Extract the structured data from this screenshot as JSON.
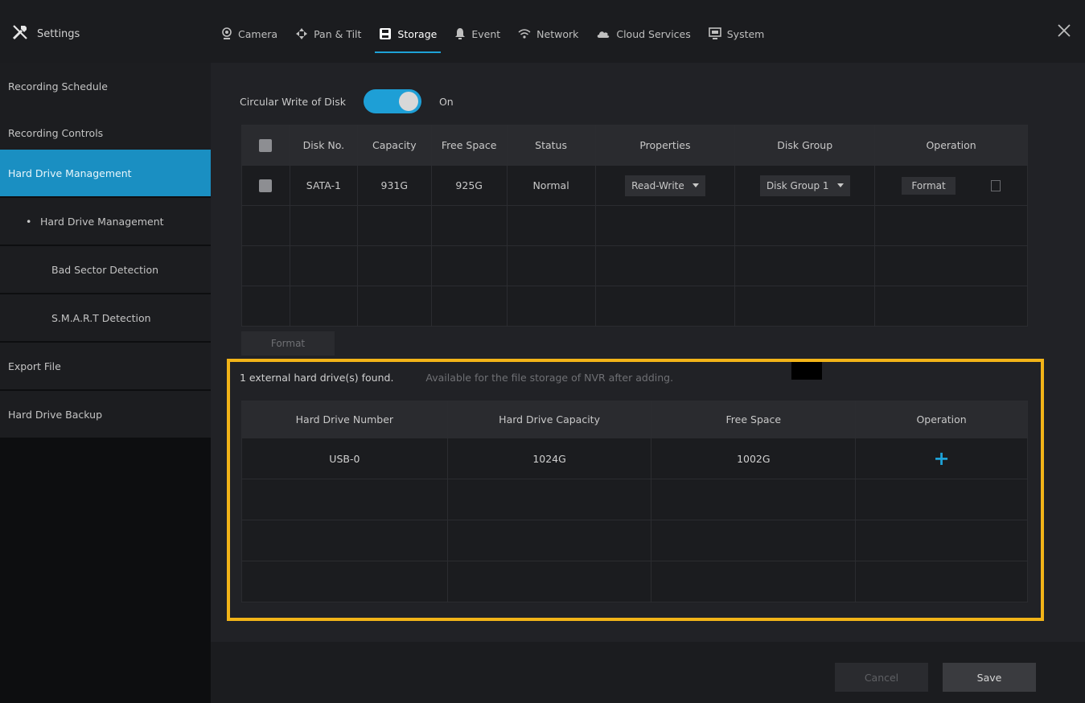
{
  "app": {
    "title": "Settings",
    "icon": "settings-tools-icon"
  },
  "nav": {
    "tabs": [
      {
        "label": "Camera",
        "icon": "camera-icon"
      },
      {
        "label": "Pan & Tilt",
        "icon": "pan-tilt-icon"
      },
      {
        "label": "Storage",
        "icon": "storage-icon",
        "active": true
      },
      {
        "label": "Event",
        "icon": "bell-icon"
      },
      {
        "label": "Network",
        "icon": "wifi-icon"
      },
      {
        "label": "Cloud Services",
        "icon": "cloud-icon"
      },
      {
        "label": "System",
        "icon": "monitor-icon"
      }
    ]
  },
  "sidebar": {
    "items": [
      {
        "label": "Recording Schedule"
      },
      {
        "label": "Recording Controls"
      },
      {
        "label": "Hard Drive Management",
        "active": true
      },
      {
        "label": "Hard Drive Management",
        "bullet": "•"
      },
      {
        "label": "Bad Sector Detection"
      },
      {
        "label": "S.M.A.R.T Detection"
      },
      {
        "label": "Export File"
      },
      {
        "label": "Hard Drive Backup"
      }
    ]
  },
  "circular": {
    "label": "Circular Write of Disk",
    "state": "On"
  },
  "disk_table": {
    "headers": [
      "Disk No.",
      "Capacity",
      "Free Space",
      "Status",
      "Properties",
      "Disk Group",
      "Operation"
    ],
    "rows": [
      {
        "disk": "SATA-1",
        "capacity": "931G",
        "free": "925G",
        "status": "Normal",
        "properties": "Read-Write",
        "group": "Disk Group 1",
        "op": "Format"
      }
    ]
  },
  "format_all_label": "Format",
  "external": {
    "found": "1 external hard drive(s) found.",
    "note": "Available for the file storage of NVR after adding.",
    "headers": [
      "Hard Drive Number",
      "Hard Drive Capacity",
      "Free Space",
      "Operation"
    ],
    "rows": [
      {
        "number": "USB-0",
        "capacity": "1024G",
        "free": "1002G",
        "op": "+"
      }
    ]
  },
  "footer": {
    "cancel": "Cancel",
    "save": "Save"
  },
  "colors": {
    "accent": "#1ea2d7",
    "highlight": "#f2b418"
  }
}
